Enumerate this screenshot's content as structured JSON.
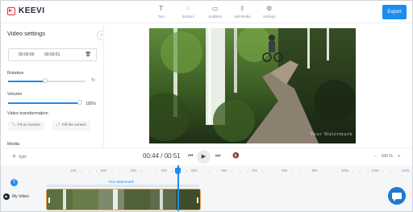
{
  "app": {
    "name": "KEEVI"
  },
  "toolbar": {
    "tools": [
      {
        "label": "Text",
        "icon": "text-icon"
      },
      {
        "label": "Stickers",
        "icon": "stickers-icon"
      },
      {
        "label": "Subtitles",
        "icon": "subtitles-icon"
      },
      {
        "label": "Add Media",
        "icon": "upload-icon"
      },
      {
        "label": "Settings",
        "icon": "gear-icon"
      }
    ],
    "export_label": "Export"
  },
  "panel": {
    "title": "Video settings",
    "trim": {
      "start": "00:00:00",
      "end": "00:00:51",
      "blank": "- -"
    },
    "rotation_label": "Rotation",
    "rotation_value": 0.45,
    "volume_label": "Volume",
    "volume_value": "100%",
    "transformation_label": "Video transformation",
    "fit_label": "Fit on screen",
    "fill_label": "Fill the screen",
    "media_label": "Media"
  },
  "preview": {
    "watermark": "Your Watermark"
  },
  "controls": {
    "split_label": "Split",
    "current_time": "00:44",
    "separator": " / ",
    "total_time": "00:51",
    "zoom_value": "100 %",
    "zoom_minus": "–",
    "zoom_plus": "+"
  },
  "timeline": {
    "ticks": [
      "10s",
      "20s",
      "30s",
      "40s",
      "50s",
      "60s",
      "70s",
      "80s",
      "90s",
      "100s",
      "110s",
      "120s"
    ],
    "watermark_track_label": "Your Watermark",
    "row_label": "My Video",
    "playhead_fraction": 0.86
  },
  "colors": {
    "accent": "#1b8df0",
    "clip_border": "#f0a04b",
    "brand": "#e0322f"
  }
}
